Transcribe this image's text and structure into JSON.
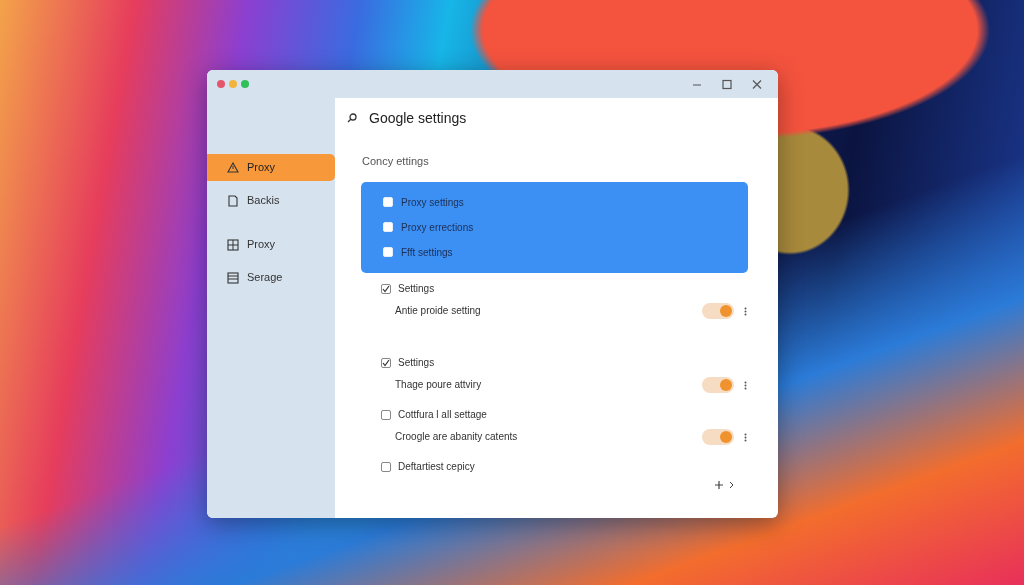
{
  "window": {
    "title": "Google settings",
    "controls": [
      {
        "kind": "minimize"
      },
      {
        "kind": "maximize"
      },
      {
        "kind": "close"
      }
    ]
  },
  "sidebar": {
    "items": [
      {
        "label": "Proxy",
        "selected": true
      },
      {
        "label": "Backis",
        "selected": false
      },
      {
        "label": "Proxy",
        "selected": false
      },
      {
        "label": "Serage",
        "selected": false
      }
    ]
  },
  "section_title": "Concy ettings",
  "panel": {
    "options": [
      {
        "label": "Proxy settings",
        "checked": false
      },
      {
        "label": "Proxy errections",
        "checked": false
      },
      {
        "label": "Ffft settings",
        "checked": false
      }
    ]
  },
  "groups": [
    {
      "label": "Settings",
      "checked": true,
      "subtitle": "Antie proide setting",
      "toggle_on": true
    },
    {
      "label": "Settings",
      "checked": true,
      "subtitle": "Thage poure attviry",
      "toggle_on": true
    },
    {
      "label": "Cottfura l all settage",
      "checked": false,
      "subtitle": "Croogle are abanity catents",
      "toggle_on": true
    },
    {
      "label": "Deftartiest cepicy",
      "checked": false
    }
  ]
}
